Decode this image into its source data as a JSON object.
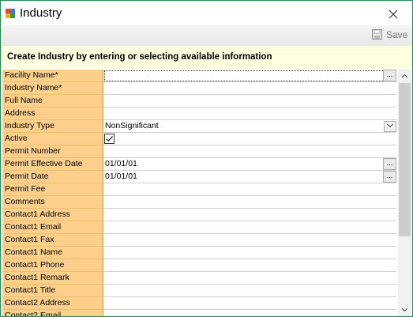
{
  "window": {
    "title": "Industry"
  },
  "toolbar": {
    "save_label": "Save"
  },
  "header": {
    "text": "Create Industry by entering or selecting available information"
  },
  "fields": [
    {
      "label": "Facility Name*",
      "value": "",
      "control": "ellipsis"
    },
    {
      "label": "Industry Name*",
      "value": ""
    },
    {
      "label": "Full Name",
      "value": ""
    },
    {
      "label": "Address",
      "value": ""
    },
    {
      "label": "Industry Type",
      "value": "NonSignificant",
      "control": "dropdown"
    },
    {
      "label": "Active",
      "value": "",
      "control": "checkbox",
      "checked": true
    },
    {
      "label": "Permit Number",
      "value": ""
    },
    {
      "label": "Permit Effective Date",
      "value": "01/01/01",
      "control": "ellipsis"
    },
    {
      "label": "Permit Date",
      "value": "01/01/01",
      "control": "ellipsis"
    },
    {
      "label": "Permit Fee",
      "value": ""
    },
    {
      "label": "Comments",
      "value": ""
    },
    {
      "label": "Contact1 Address",
      "value": ""
    },
    {
      "label": "Contact1 Email",
      "value": ""
    },
    {
      "label": "Contact1 Fax",
      "value": ""
    },
    {
      "label": "Contact1 Name",
      "value": ""
    },
    {
      "label": "Contact1 Phone",
      "value": ""
    },
    {
      "label": "Contact1 Remark",
      "value": ""
    },
    {
      "label": "Contact1 Title",
      "value": ""
    },
    {
      "label": "Contact2 Address",
      "value": ""
    },
    {
      "label": "Contact2 Email",
      "value": ""
    }
  ],
  "buttons": {
    "ellipsis": "..."
  },
  "colors": {
    "label_bg": "#fcd08a",
    "header_bg": "#fffde0",
    "window_border": "#1e8d50"
  },
  "icons": [
    "app-icon",
    "close-icon",
    "save-disk-icon",
    "dropdown-chevron-icon",
    "checkmark-icon",
    "scroll-up-icon",
    "scroll-down-icon"
  ]
}
